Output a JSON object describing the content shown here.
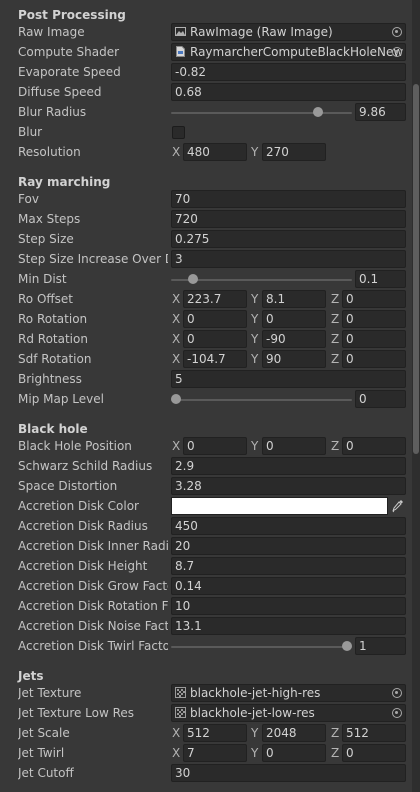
{
  "post_processing": {
    "header": "Post Processing",
    "raw_image": {
      "label": "Raw Image",
      "value": "RawImage (Raw Image)"
    },
    "compute_shader": {
      "label": "Compute Shader",
      "value": "RaymarcherComputeBlackHoleNew"
    },
    "evaporate_speed": {
      "label": "Evaporate Speed",
      "value": "-0.82"
    },
    "diffuse_speed": {
      "label": "Diffuse Speed",
      "value": "0.68"
    },
    "blur_radius": {
      "label": "Blur Radius",
      "value": "9.86",
      "fraction": 0.83
    },
    "blur": {
      "label": "Blur",
      "checked": false
    },
    "resolution": {
      "label": "Resolution",
      "x_axis": "X",
      "x": "480",
      "y_axis": "Y",
      "y": "270"
    }
  },
  "ray_marching": {
    "header": "Ray marching",
    "fov": {
      "label": "Fov",
      "value": "70"
    },
    "max_steps": {
      "label": "Max Steps",
      "value": "720"
    },
    "step_size": {
      "label": "Step Size",
      "value": "0.275"
    },
    "step_size_increase": {
      "label": "Step Size Increase Over Di",
      "value": "3"
    },
    "min_dist": {
      "label": "Min Dist",
      "value": "0.1",
      "fraction": 0.1
    },
    "ro_offset": {
      "label": "Ro Offset",
      "x_axis": "X",
      "x": "223.7",
      "y_axis": "Y",
      "y": "8.1",
      "z_axis": "Z",
      "z": "0"
    },
    "ro_rotation": {
      "label": "Ro Rotation",
      "x_axis": "X",
      "x": "0",
      "y_axis": "Y",
      "y": "0",
      "z_axis": "Z",
      "z": "0"
    },
    "rd_rotation": {
      "label": "Rd Rotation",
      "x_axis": "X",
      "x": "0",
      "y_axis": "Y",
      "y": "-90",
      "z_axis": "Z",
      "z": "0"
    },
    "sdf_rotation": {
      "label": "Sdf Rotation",
      "x_axis": "X",
      "x": "-104.7",
      "y_axis": "Y",
      "y": "90",
      "z_axis": "Z",
      "z": "0"
    },
    "brightness": {
      "label": "Brightness",
      "value": "5"
    },
    "mip_map_level": {
      "label": "Mip Map Level",
      "value": "0",
      "fraction": 0.0
    }
  },
  "black_hole": {
    "header": "Black hole",
    "position": {
      "label": "Black Hole Position",
      "x_axis": "X",
      "x": "0",
      "y_axis": "Y",
      "y": "0",
      "z_axis": "Z",
      "z": "0"
    },
    "schwarz_schild_radius": {
      "label": "Schwarz Schild Radius",
      "value": "2.9"
    },
    "space_distortion": {
      "label": "Space Distortion",
      "value": "3.28"
    },
    "accretion_disk_color": {
      "label": "Accretion Disk Color",
      "color": "#ffffff"
    },
    "accretion_disk_radius": {
      "label": "Accretion Disk Radius",
      "value": "450"
    },
    "accretion_disk_inner_radius": {
      "label": "Accretion Disk Inner Radius",
      "value": "20"
    },
    "accretion_disk_height": {
      "label": "Accretion Disk Height",
      "value": "8.7"
    },
    "accretion_disk_grow_factor": {
      "label": "Accretion Disk Grow Facto",
      "value": "0.14"
    },
    "accretion_disk_rotation_factor": {
      "label": "Accretion Disk Rotation Fac",
      "value": "10"
    },
    "accretion_disk_noise_factor": {
      "label": "Accretion Disk Noise Facto",
      "value": "13.1"
    },
    "accretion_disk_twirl_factor": {
      "label": "Accretion Disk Twirl Factor",
      "value": "1",
      "fraction": 1.0
    }
  },
  "jets": {
    "header": "Jets",
    "jet_texture": {
      "label": "Jet Texture",
      "value": "blackhole-jet-high-res"
    },
    "jet_texture_low_res": {
      "label": "Jet Texture Low Res",
      "value": "blackhole-jet-low-res"
    },
    "jet_scale": {
      "label": "Jet Scale",
      "x_axis": "X",
      "x": "512",
      "y_axis": "Y",
      "y": "2048",
      "z_axis": "Z",
      "z": "512"
    },
    "jet_twirl": {
      "label": "Jet Twirl",
      "x_axis": "X",
      "x": "7",
      "y_axis": "Y",
      "y": "0",
      "z_axis": "Z",
      "z": "0"
    },
    "jet_cutoff": {
      "label": "Jet Cutoff",
      "value": "30"
    }
  },
  "icons": {
    "raw_image": "raw-image-icon",
    "compute_shader": "compute-shader-icon",
    "texture": "texture-icon",
    "object_picker": "object-picker-icon",
    "eyedropper": "eyedropper-icon"
  }
}
